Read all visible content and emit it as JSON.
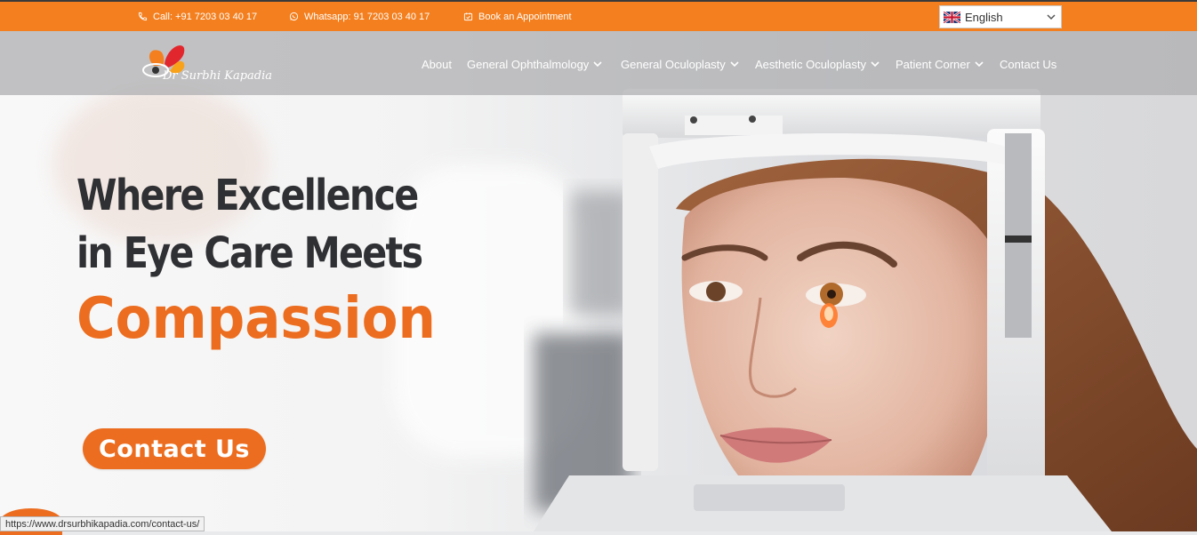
{
  "topbar": {
    "call": "Call: +91 7203 03 40 17",
    "whatsapp": "Whatsapp: 91 7203 03 40 17",
    "appointment": "Book an Appointment",
    "language": "English"
  },
  "logo": {
    "text": "Dr Surbhi Kapadia"
  },
  "nav": {
    "about": "About",
    "general_ophthalmology": "General Ophthalmology",
    "general_oculoplasty": "General Oculoplasty",
    "aesthetic_oculoplasty": "Aesthetic Oculoplasty",
    "patient_corner": "Patient Corner",
    "contact_us": "Contact Us"
  },
  "hero": {
    "line1": "Where Excellence",
    "line2": "in Eye Care Meets",
    "highlight": "Compassion",
    "cta": "Contact Us"
  },
  "status_url": "https://www.drsurbhikapadia.com/contact-us/",
  "colors": {
    "accent": "#f47f1e",
    "heading": "#2f3033",
    "highlight": "#ec6d1f"
  }
}
